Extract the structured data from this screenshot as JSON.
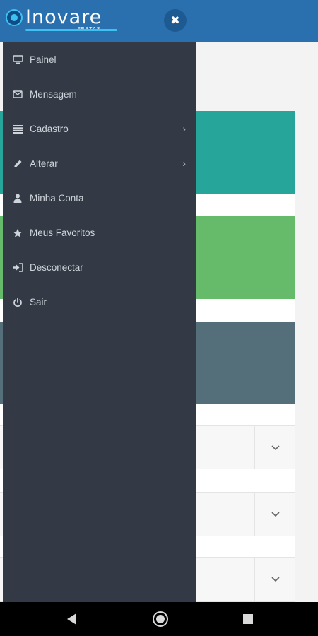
{
  "app": {
    "logo_text": "Inovare",
    "logo_subtext": "FESTAS",
    "close_symbol": "✖"
  },
  "menu": {
    "items": [
      {
        "label": "Painel",
        "icon": "monitor-icon",
        "has_submenu": false
      },
      {
        "label": "Mensagem",
        "icon": "envelope-icon",
        "has_submenu": false
      },
      {
        "label": "Cadastro",
        "icon": "list-icon",
        "has_submenu": true
      },
      {
        "label": "Alterar",
        "icon": "pencil-icon",
        "has_submenu": true
      },
      {
        "label": "Minha Conta",
        "icon": "user-icon",
        "has_submenu": false
      },
      {
        "label": "Meus Favoritos",
        "icon": "star-icon",
        "has_submenu": false
      },
      {
        "label": "Desconectar",
        "icon": "sign-in-icon",
        "has_submenu": false
      },
      {
        "label": "Sair",
        "icon": "power-icon",
        "has_submenu": false
      }
    ],
    "submenu_arrow": "›"
  },
  "dashboard": {
    "cards": [
      {
        "color": "#26a69a"
      },
      {
        "color": "#66bb6a"
      },
      {
        "color": "#546e7a"
      }
    ],
    "accordion_chevron": "⌄"
  },
  "colors": {
    "appbar": "#2a6fae",
    "drawer": "#333a45",
    "menu_text": "#cfd4da"
  }
}
